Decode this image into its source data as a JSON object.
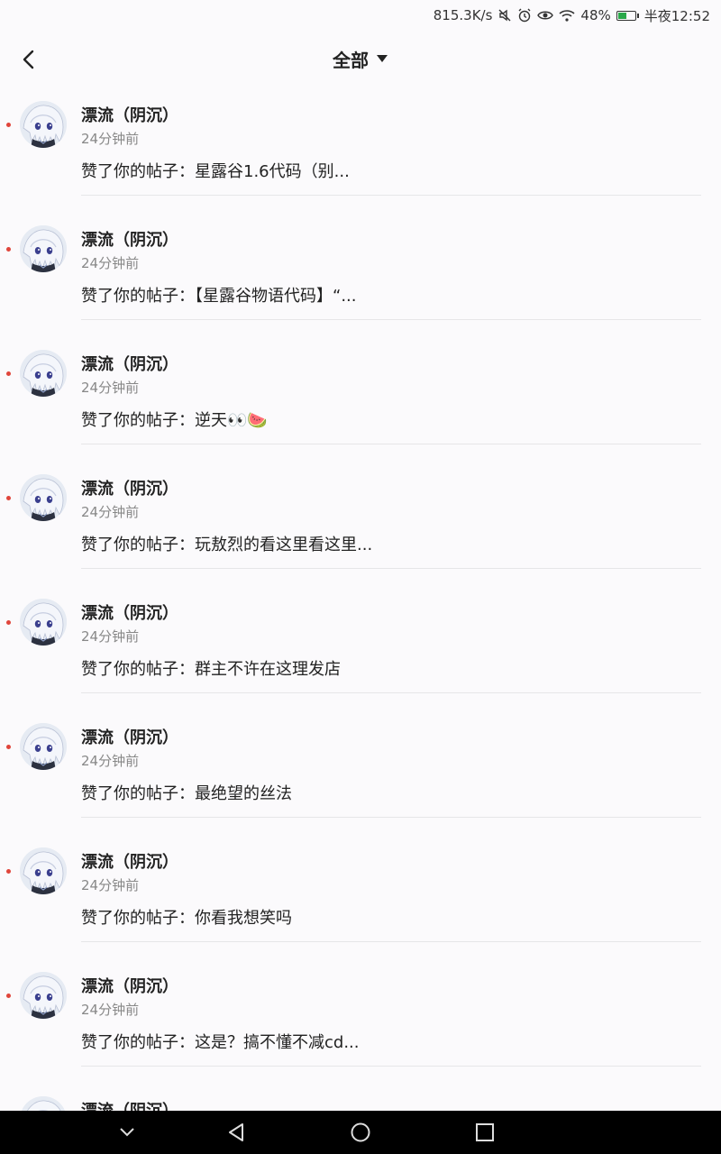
{
  "status_bar": {
    "speed": "815.3K/s",
    "battery": "48%",
    "battery_level": 0.48,
    "time": "半夜12:52",
    "icons": [
      "mute-icon",
      "alarm-icon",
      "eye-icon",
      "wifi-icon",
      "battery-icon"
    ]
  },
  "header": {
    "filter_label": "全部"
  },
  "notifications": [
    {
      "name": "漂流（阴沉）",
      "time": "24分钟前",
      "content": "赞了你的帖子：星露谷1.6代码（别..."
    },
    {
      "name": "漂流（阴沉）",
      "time": "24分钟前",
      "content": "赞了你的帖子：【星露谷物语代码】“..."
    },
    {
      "name": "漂流（阴沉）",
      "time": "24分钟前",
      "content": "赞了你的帖子：逆天👀🍉"
    },
    {
      "name": "漂流（阴沉）",
      "time": "24分钟前",
      "content": "赞了你的帖子：玩敖烈的看这里看这里..."
    },
    {
      "name": "漂流（阴沉）",
      "time": "24分钟前",
      "content": "赞了你的帖子：群主不许在这理发店"
    },
    {
      "name": "漂流（阴沉）",
      "time": "24分钟前",
      "content": "赞了你的帖子：最绝望的丝法"
    },
    {
      "name": "漂流（阴沉）",
      "time": "24分钟前",
      "content": "赞了你的帖子：你看我想笑吗"
    },
    {
      "name": "漂流（阴沉）",
      "time": "24分钟前",
      "content": "赞了你的帖子：这是？搞不懂不减cd..."
    },
    {
      "name": "漂流（阴沉）",
      "time": "",
      "content": ""
    }
  ],
  "colors": {
    "unread_dot": "#e0453b",
    "battery_fill": "#2aa84a",
    "nav_bar": "#000000"
  }
}
